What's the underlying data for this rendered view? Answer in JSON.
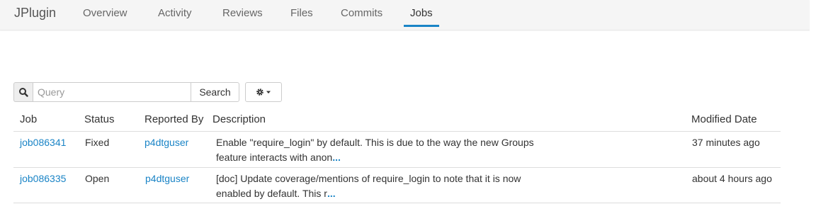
{
  "header": {
    "brand": "JPlugin",
    "tabs": [
      {
        "label": "Overview"
      },
      {
        "label": "Activity"
      },
      {
        "label": "Reviews"
      },
      {
        "label": "Files"
      },
      {
        "label": "Commits"
      },
      {
        "label": "Jobs",
        "active": true
      }
    ]
  },
  "toolbar": {
    "search_placeholder": "Query",
    "search_value": "",
    "search_button_label": "Search",
    "search_icon": "search-icon",
    "settings_icon": "gear-icon",
    "settings_caret_icon": "caret-down-icon"
  },
  "table": {
    "columns": [
      "Job",
      "Status",
      "Reported By",
      "Description",
      "Modified Date"
    ],
    "rows": [
      {
        "job": "job086341",
        "status": "Fixed",
        "reported_by": "p4dtguser",
        "description": "Enable \"require_login\" by default. This is due to the way the new Groups feature interacts with anon",
        "more": "...",
        "modified": "37 minutes ago"
      },
      {
        "job": "job086335",
        "status": "Open",
        "reported_by": "p4dtguser",
        "description": "[doc] Update coverage/mentions of require_login to note that it is now enabled by default. This r",
        "more": "...",
        "modified": "about 4 hours ago"
      }
    ]
  },
  "colors": {
    "accent": "#1a84c6",
    "topbar_bg": "#f5f5f5",
    "border": "#cccccc"
  }
}
